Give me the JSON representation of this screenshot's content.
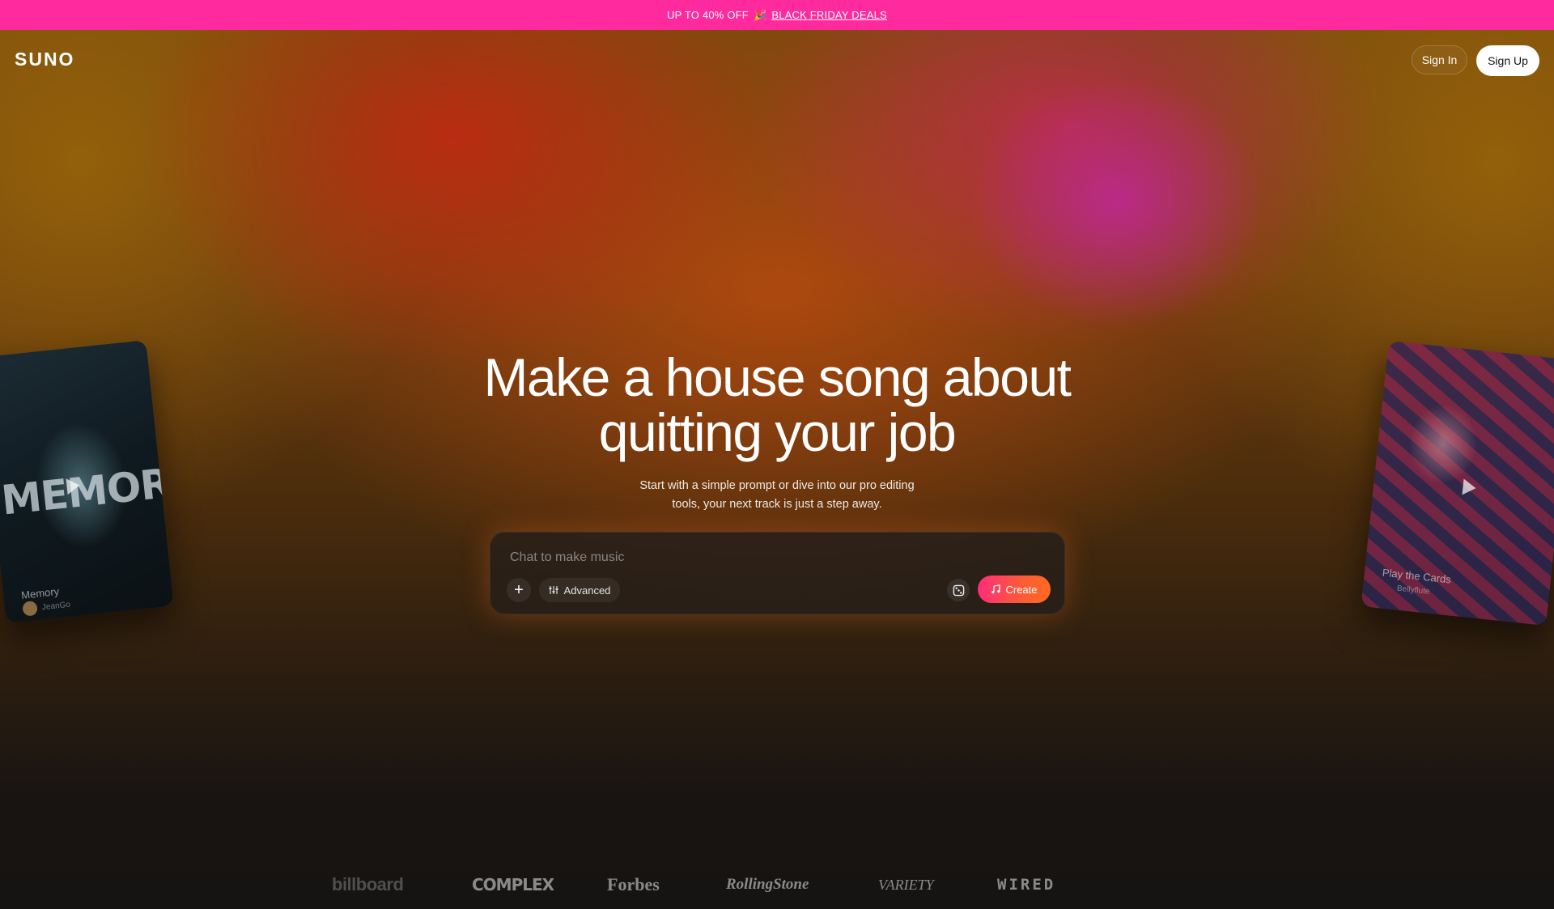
{
  "promo": {
    "text": "UP TO 40% OFF",
    "emoji": "🎉",
    "link": "BLACK FRIDAY DEALS"
  },
  "header": {
    "logo": "SUNO",
    "sign_in": "Sign In",
    "sign_up": "Sign Up"
  },
  "hero": {
    "title_line1": "Make a house song about",
    "title_line2": "quitting your job",
    "subtitle_line1": "Start with a simple prompt or dive into our pro editing",
    "subtitle_line2": "tools, your next track is just a step away."
  },
  "composer": {
    "placeholder": "Chat to make music",
    "value": "",
    "plus_icon": "plus-icon",
    "advanced_label": "Advanced",
    "advanced_icon": "sliders-icon",
    "dice_icon": "dice-icon",
    "create_label": "Create",
    "create_icon": "music-note-icon"
  },
  "cards": {
    "left": {
      "art_text": "MEMORY",
      "title": "Memory",
      "artist": "JeanGo"
    },
    "right": {
      "title": "Play the Cards",
      "artist": "Bellyflute"
    }
  },
  "press": [
    "billboard",
    "COMPLEX",
    "Forbes",
    "RollingStone",
    "VARIETY",
    "WIRED"
  ],
  "colors": {
    "promo_bg": "#ff2a9e",
    "create_gradient_start": "#ff2d7a",
    "create_gradient_end": "#ff6a22",
    "signup_bg": "#ffffff"
  }
}
